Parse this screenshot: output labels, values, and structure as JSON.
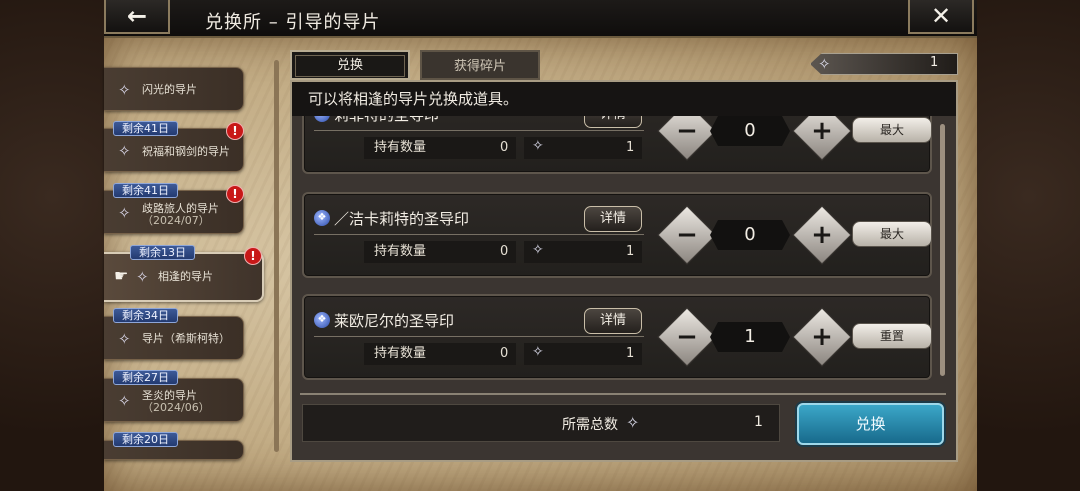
{
  "header": {
    "title": "兑换所 – 引导的导片",
    "back_glyph": "←",
    "close_glyph": "✕"
  },
  "sidebar": {
    "items": [
      {
        "label": "闪光的导片",
        "days": "",
        "alert": false
      },
      {
        "label": "祝福和钢剑的导片",
        "days": "剩余41日",
        "alert": true
      },
      {
        "label": "歧路旅人的导片",
        "label2": "（2024/07）",
        "days": "剩余41日",
        "alert": true
      },
      {
        "label": "相逢的导片",
        "days": "剩余13日",
        "alert": true,
        "active": true
      },
      {
        "label": "导片（希斯柯特）",
        "days": "剩余34日",
        "alert": false
      },
      {
        "label": "圣炎的导片",
        "label2": "（2024/06）",
        "days": "剩余27日",
        "alert": false
      },
      {
        "label": "",
        "days": "剩余20日",
        "alert": false
      }
    ],
    "alert_glyph": "!"
  },
  "tabs": {
    "exchange": "兑换",
    "fragments": "获得碎片"
  },
  "currency": {
    "value": "1"
  },
  "description": "可以将相逢的导片兑换成道具。",
  "items": [
    {
      "title": "莉菲特的圣导印",
      "detail": "详情",
      "hold_label": "持有数量",
      "hold_count": "0",
      "required": "1",
      "quantity": "0",
      "minus": "−",
      "plus": "+",
      "action": "最大"
    },
    {
      "title": "／洁卡莉特的圣导印",
      "detail": "详情",
      "hold_label": "持有数量",
      "hold_count": "0",
      "required": "1",
      "quantity": "0",
      "minus": "−",
      "plus": "+",
      "action": "最大"
    },
    {
      "title": "莱欧尼尔的圣导印",
      "detail": "详情",
      "hold_label": "持有数量",
      "hold_count": "0",
      "required": "1",
      "quantity": "1",
      "minus": "−",
      "plus": "+",
      "action": "重置"
    }
  ],
  "footer": {
    "total_label": "所需总数",
    "total_value": "1",
    "exchange_button": "兑换"
  },
  "icons": {
    "gem_glyph": "✧",
    "item_glyph": "❖",
    "pointer_glyph": "☛"
  },
  "colors": {
    "parchment": "#c3ad86",
    "panel": "#3b3531",
    "exchange_button": "#2a8eb0",
    "alert": "#c81818",
    "days_badge": "#2f4c88"
  }
}
